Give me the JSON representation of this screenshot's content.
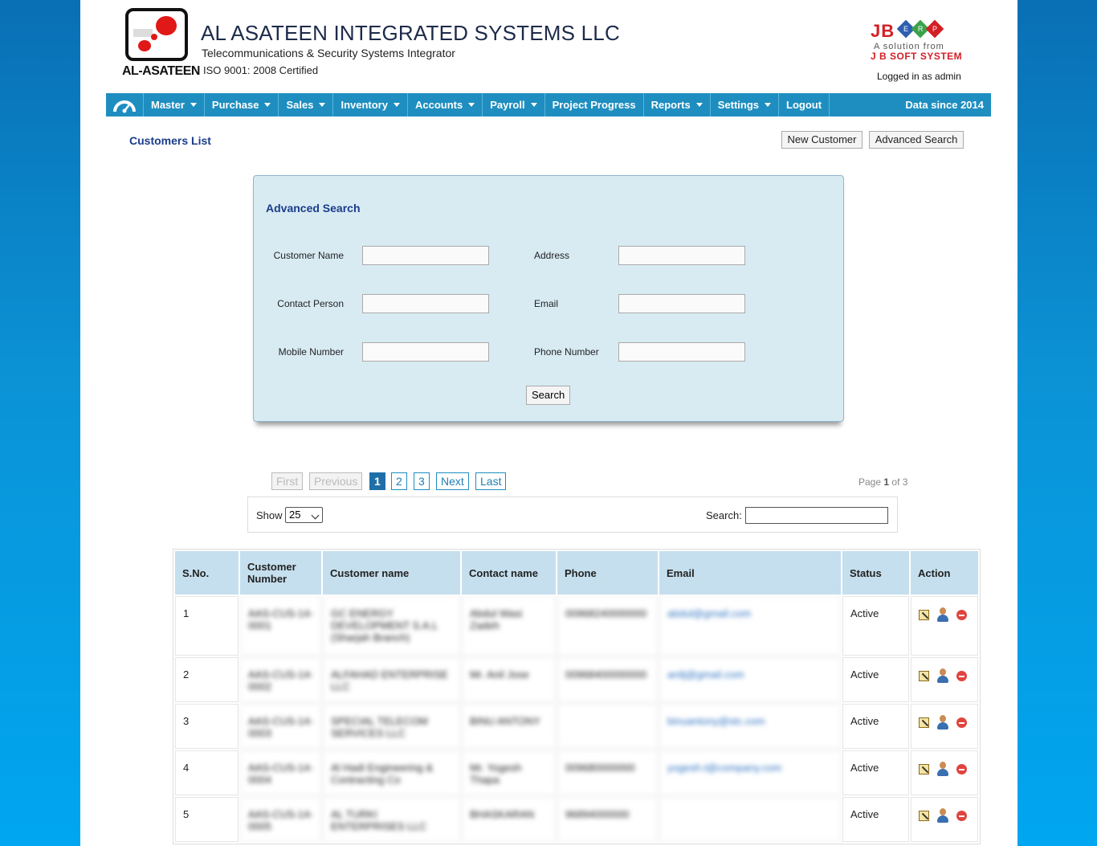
{
  "header": {
    "logo_text": "AL-ASATEEN",
    "company": "AL ASATEEN INTEGRATED SYSTEMS LLC",
    "tagline": "Telecommunications & Security Systems Integrator",
    "iso": "ISO 9001: 2008 Certified",
    "jb_logo": "JB",
    "jb_letters": [
      "E",
      "R",
      "P"
    ],
    "jb_solution": "A solution from",
    "jb_company": "J B SOFT SYSTEM",
    "logged_in": "Logged in as admin",
    "colors": {
      "nav": "#1e8ec0",
      "brand_red": "#d31f26",
      "title_blue": "#1a3c8a"
    }
  },
  "nav": {
    "home_icon": "dashboard-icon",
    "items": [
      {
        "label": "Master",
        "dropdown": true
      },
      {
        "label": "Purchase",
        "dropdown": true
      },
      {
        "label": "Sales",
        "dropdown": true
      },
      {
        "label": "Inventory",
        "dropdown": true
      },
      {
        "label": "Accounts",
        "dropdown": true
      },
      {
        "label": "Payroll",
        "dropdown": true
      },
      {
        "label": "Project Progress",
        "dropdown": false
      },
      {
        "label": "Reports",
        "dropdown": true
      },
      {
        "label": "Settings",
        "dropdown": true
      },
      {
        "label": "Logout",
        "dropdown": false
      }
    ],
    "data_since": "Data since 2014"
  },
  "page": {
    "title": "Customers List",
    "new_customer": "New Customer",
    "advanced_search": "Advanced Search"
  },
  "adv": {
    "title": "Advanced Search",
    "customer_name": "Customer Name",
    "address": "Address",
    "contact_person": "Contact Person",
    "email": "Email",
    "mobile_number": "Mobile Number",
    "phone_number": "Phone Number",
    "search": "Search"
  },
  "pager": {
    "first": "First",
    "previous": "Previous",
    "pages": [
      "1",
      "2",
      "3"
    ],
    "next": "Next",
    "last": "Last",
    "page_prefix": "Page",
    "current": "1",
    "of": "of",
    "total": "3"
  },
  "tools": {
    "show": "Show",
    "show_value": "25",
    "search": "Search:"
  },
  "table": {
    "headers": [
      "S.No.",
      "Customer Number",
      "Customer name",
      "Contact name",
      "Phone",
      "Email",
      "Status",
      "Action"
    ],
    "rows": [
      {
        "sno": "1",
        "cust_no": "AAS-CUS-14-0001",
        "name": "GC ENERGY DEVELOPMENT S.A.L (Sharjah Branch)",
        "contact": "Abdul Wasi Zadeh",
        "phone": "00968240000000",
        "email": "abdul@gmail.com",
        "status": "Active"
      },
      {
        "sno": "2",
        "cust_no": "AAS-CUS-14-0002",
        "name": "ALFAHAD ENTERPRISE LLC",
        "contact": "Mr. Anil Jose",
        "phone": "00968400000000",
        "email": "anilj@gmail.com",
        "status": "Active"
      },
      {
        "sno": "3",
        "cust_no": "AAS-CUS-14-0003",
        "name": "SPECIAL TELECOM SERVICES LLC",
        "contact": "BINU ANTONY",
        "phone": "",
        "email": "binuantony@stc.com",
        "status": "Active"
      },
      {
        "sno": "4",
        "cust_no": "AAS-CUS-14-0004",
        "name": "Al Hadi Engineering & Contracting Co",
        "contact": "Mr. Yogesh Thapa",
        "phone": "009680000000",
        "email": "yogesh.t@company.com",
        "status": "Active"
      },
      {
        "sno": "5",
        "cust_no": "AAS-CUS-14-0005",
        "name": "AL TURKI ENTERPRISES LLC",
        "contact": "BHASKARAN",
        "phone": "96894000000",
        "email": "",
        "status": "Active"
      }
    ],
    "action_icons": [
      "edit-icon",
      "user-icon",
      "delete-icon"
    ]
  }
}
